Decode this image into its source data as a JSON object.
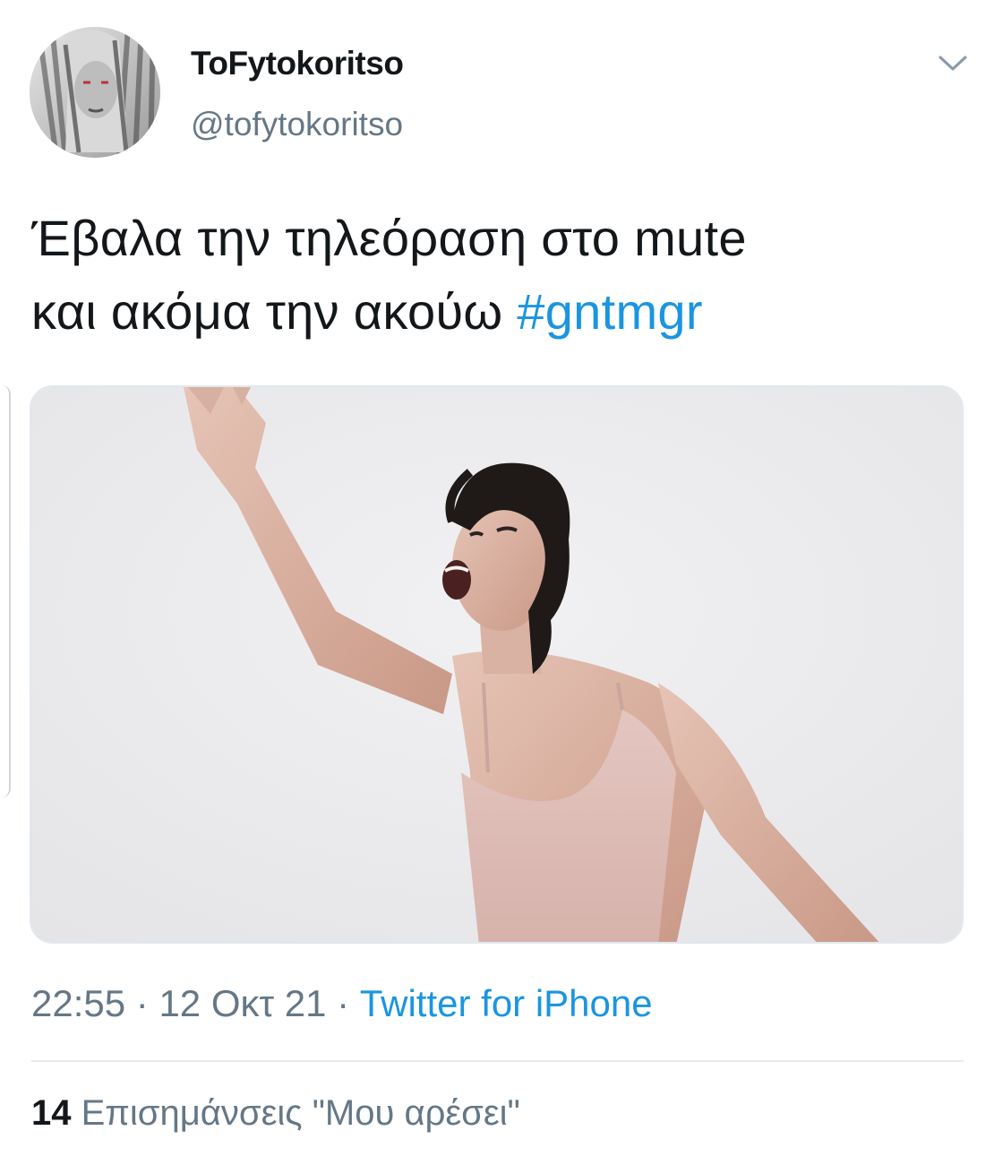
{
  "user": {
    "display_name": "ToFytokoritso",
    "handle": "@tofytokoritso",
    "avatar": "profile-photo"
  },
  "tweet": {
    "text_line1": "Έβαλα την τηλεόραση στο mute",
    "text_line2": "και ακόμα την ακούω",
    "hashtag": "#gntmgr",
    "media": "photo-woman-shouting-raised-arm"
  },
  "meta": {
    "time": "22:55",
    "separator": " · ",
    "date": "12 Οκτ 21",
    "source": "Twitter for iPhone"
  },
  "stats": {
    "likes_count": "14",
    "likes_label": "Επισημάνσεις \"Μου αρέσει\""
  },
  "icons": {
    "more": "chevron-down-icon"
  },
  "colors": {
    "link": "#1b95e0",
    "secondary_text": "#657786",
    "primary_text": "#14171a",
    "divider": "#e6ecf0"
  }
}
